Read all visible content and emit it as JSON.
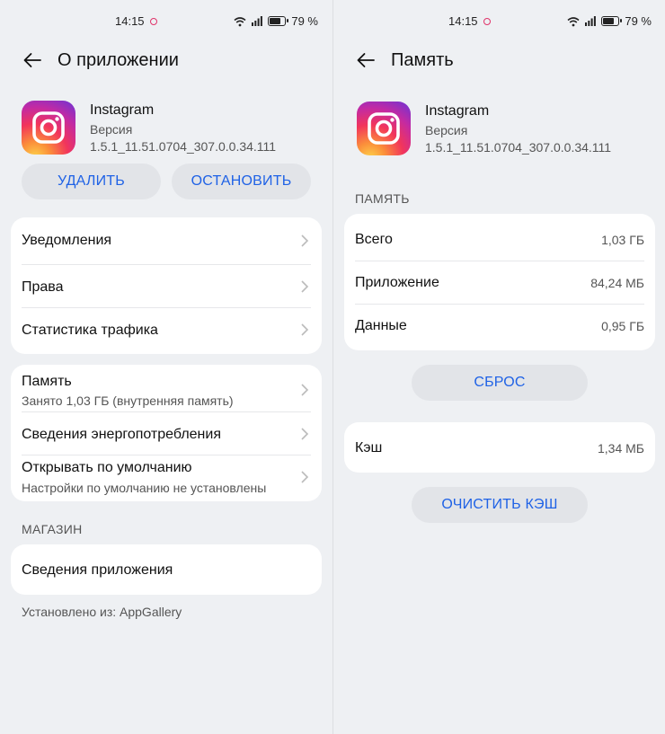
{
  "status_bar": {
    "time": "14:15",
    "battery": "79 %",
    "battery_level": 0.79
  },
  "left": {
    "title": "О приложении",
    "app": {
      "name": "Instagram",
      "version_label": "Версия",
      "version": "1.5.1_11.51.0704_307.0.0.34.111"
    },
    "buttons": {
      "uninstall": "УДАЛИТЬ",
      "stop": "ОСТАНОВИТЬ"
    },
    "group1": [
      "Уведомления",
      "Права",
      "Статистика трафика"
    ],
    "storage": {
      "title": "Память",
      "subtitle": "Занято 1,03 ГБ (внутренняя память)"
    },
    "energy": "Сведения энергопотребления",
    "defaults": {
      "title": "Открывать по умолчанию",
      "subtitle": "Настройки по умолчанию не установлены"
    },
    "store_section": "МАГАЗИН",
    "app_details": "Сведения приложения",
    "installed_from": "Установлено из: AppGallery"
  },
  "right": {
    "title": "Память",
    "app": {
      "name": "Instagram",
      "version_label": "Версия",
      "version": "1.5.1_11.51.0704_307.0.0.34.111"
    },
    "section": "ПАМЯТЬ",
    "rows": [
      {
        "label": "Всего",
        "value": "1,03 ГБ"
      },
      {
        "label": "Приложение",
        "value": "84,24 МБ"
      },
      {
        "label": "Данные",
        "value": "0,95 ГБ"
      }
    ],
    "reset_button": "СБРОС",
    "cache": {
      "label": "Кэш",
      "value": "1,34 МБ"
    },
    "clear_cache_button": "ОЧИСТИТЬ КЭШ"
  }
}
